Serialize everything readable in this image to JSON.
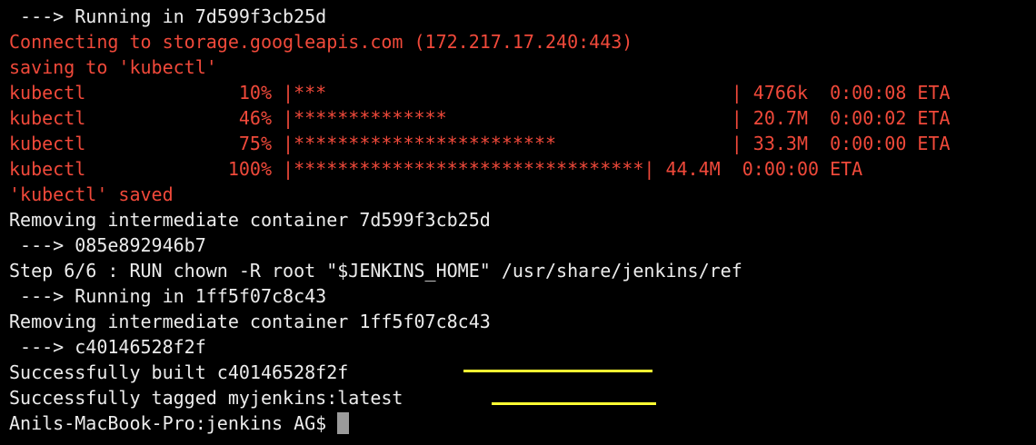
{
  "terminal": {
    "text_color": "#ececec",
    "error_color": "#f0493a",
    "highlight_color": "#ffff33",
    "lines": {
      "l01": " ---> Running in 7d599f3cb25d",
      "l02": "Connecting to storage.googleapis.com (172.217.17.240:443)",
      "l03": "saving to 'kubectl'",
      "l04": "kubectl              10% |***                                     | 4766k  0:00:08 ETA",
      "l05": "kubectl              46% |**************                          | 20.7M  0:00:02 ETA",
      "l06": "kubectl              75% |************************                | 33.3M  0:00:00 ETA",
      "l07": "kubectl             100% |********************************| 44.4M  0:00:00 ETA",
      "l08": "'kubectl' saved",
      "l09": "Removing intermediate container 7d599f3cb25d",
      "l10": " ---> 085e892946b7",
      "l11": "Step 6/6 : RUN chown -R root \"$JENKINS_HOME\" /usr/share/jenkins/ref",
      "l12": " ---> Running in 1ff5f07c8c43",
      "l13": "Removing intermediate container 1ff5f07c8c43",
      "l14": " ---> c40146528f2f",
      "l15": "Successfully built c40146528f2f",
      "l16": "Successfully tagged myjenkins:latest",
      "l17": "Anils-MacBook-Pro:jenkins AG$ "
    }
  }
}
